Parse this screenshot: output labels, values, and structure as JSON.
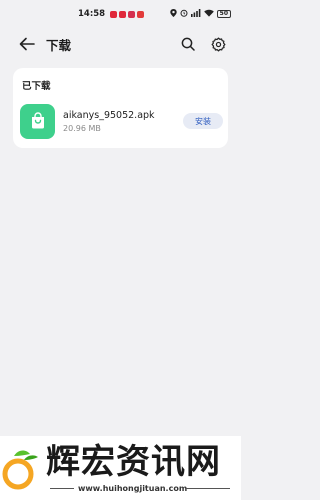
{
  "status_bar": {
    "time": "14:58",
    "notification_icon_colors": [
      "#e0283a",
      "#e0283a",
      "#d4304f",
      "#e23a3a"
    ],
    "icons": [
      "location-icon",
      "alarm-icon",
      "signal-icon",
      "wifi-icon"
    ],
    "battery": "50"
  },
  "header": {
    "title": "下载",
    "icons": [
      "back-arrow-icon",
      "search-icon",
      "settings-icon"
    ]
  },
  "downloads": {
    "section_label": "已下载",
    "items": [
      {
        "name": "aikanys_95052.apk",
        "size": "20.96 MB",
        "action_label": "安装",
        "icon": "shopping-bag-icon",
        "icon_color": "#3ed08c"
      }
    ]
  },
  "watermark": {
    "title": "辉宏资讯网",
    "url": "www.huihongjituan.com"
  },
  "colors": {
    "background": "#f1f1f3",
    "card": "#ffffff",
    "accent": "#2d5bbf",
    "install_bg": "#e7ebf5"
  }
}
